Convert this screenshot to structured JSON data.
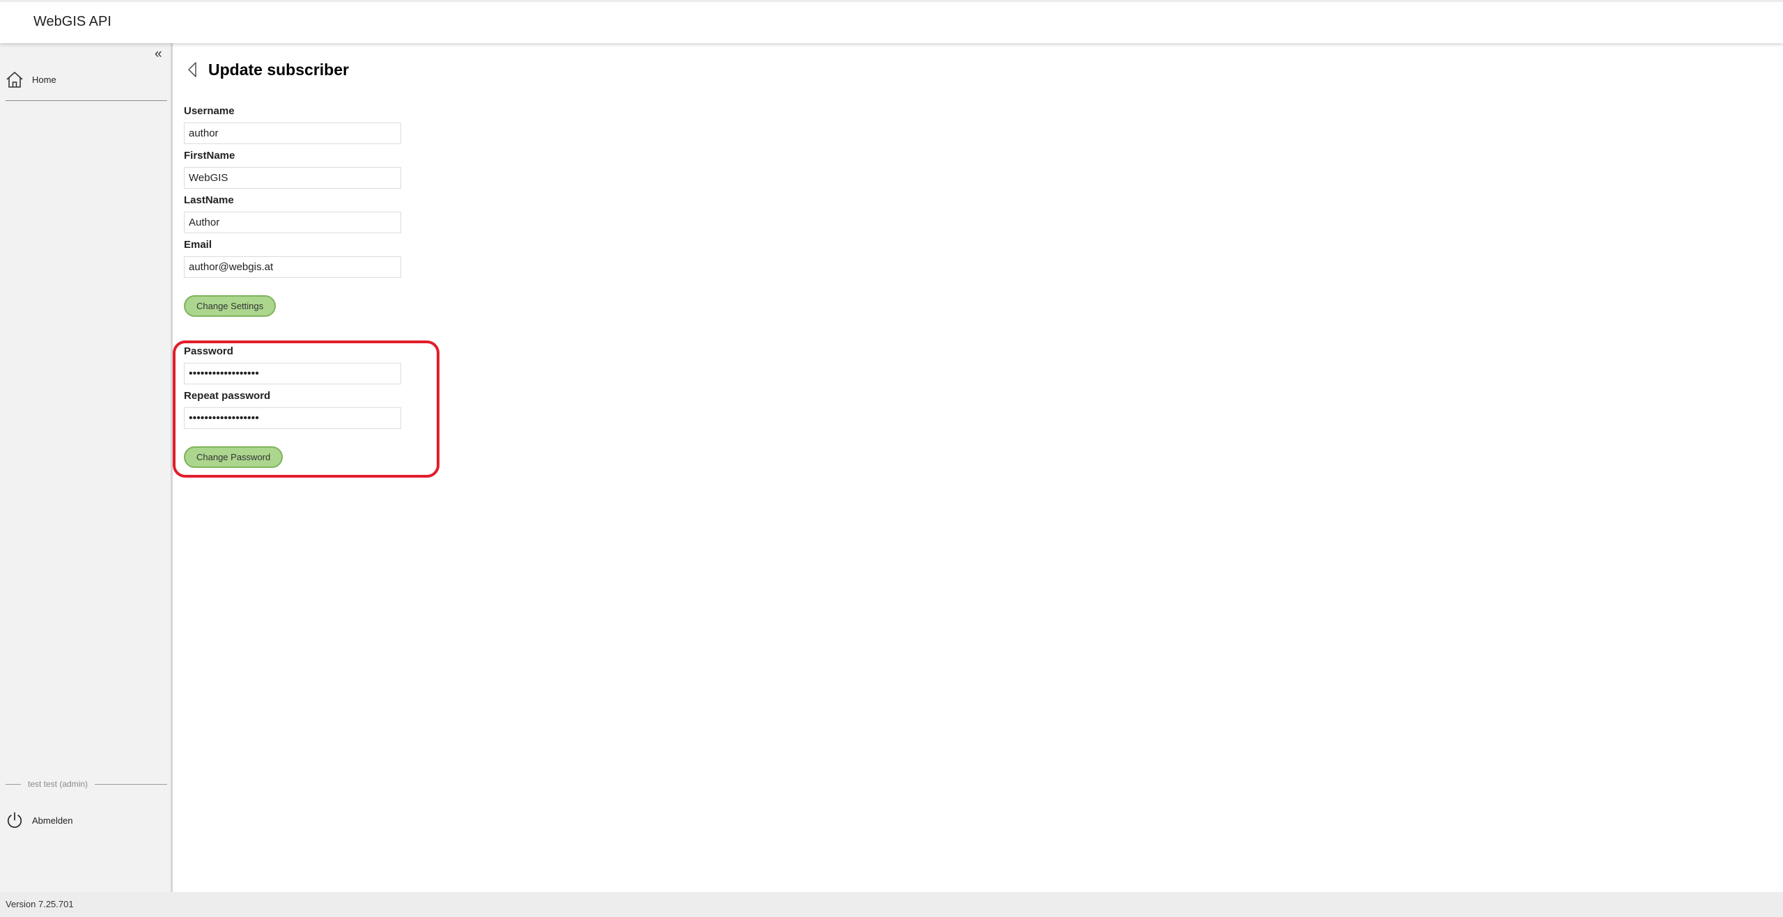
{
  "app": {
    "title": "WebGIS API"
  },
  "sidebar": {
    "collapse_glyph": "«",
    "items": [
      {
        "label": "Home",
        "icon": "home-icon"
      }
    ],
    "user_label": "test test (admin)",
    "logout": {
      "label": "Abmelden",
      "icon": "power-icon"
    }
  },
  "footer": {
    "version": "Version 7.25.701"
  },
  "page": {
    "title": "Update subscriber",
    "fields": {
      "username": {
        "label": "Username",
        "value": "author"
      },
      "firstname": {
        "label": "FirstName",
        "value": "WebGIS"
      },
      "lastname": {
        "label": "LastName",
        "value": "Author"
      },
      "email": {
        "label": "Email",
        "value": "author@webgis.at"
      }
    },
    "change_settings_label": "Change Settings",
    "password": {
      "label": "Password",
      "value": "••••••••••••••••••"
    },
    "repeat_password": {
      "label": "Repeat password",
      "value": "••••••••••••••••••"
    },
    "change_password_label": "Change Password"
  },
  "colors": {
    "button_fill": "#acd68e",
    "button_border": "#7db55b",
    "highlight": "#e31d2b",
    "sidebar_bg": "#f2f2f2"
  }
}
